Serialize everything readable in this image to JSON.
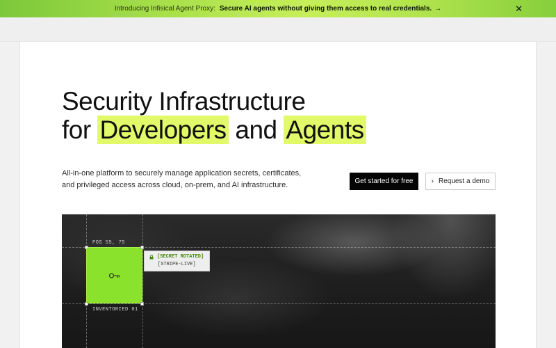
{
  "banner": {
    "intro": "Introducing Infisical Agent Proxy:",
    "cta": "Secure AI agents without giving them access to real credentials.",
    "cta_arrow": "→",
    "close": "✕"
  },
  "hero": {
    "title_line1": "Security Infrastructure",
    "title_for": "for",
    "title_hl1": "Developers",
    "title_and": "and",
    "title_hl2": "Agents",
    "description": "All-in-one platform to securely manage application secrets, certificates, and privileged access across cloud, on-prem, and AI infrastructure.",
    "primary_button": "Get started for free",
    "secondary_button": "Request a demo",
    "secondary_chevron": "›"
  },
  "visual": {
    "pos_label": "POS 55, 75",
    "inventoried_label": "INVENTORIED 01",
    "tag_status": "[SECRET ROTATED]",
    "tag_name": "[STRIPE-LIVE]"
  },
  "colors": {
    "highlight": "#e2f96a",
    "key_box": "#8be22c",
    "banner_green": "#a8e04a"
  }
}
